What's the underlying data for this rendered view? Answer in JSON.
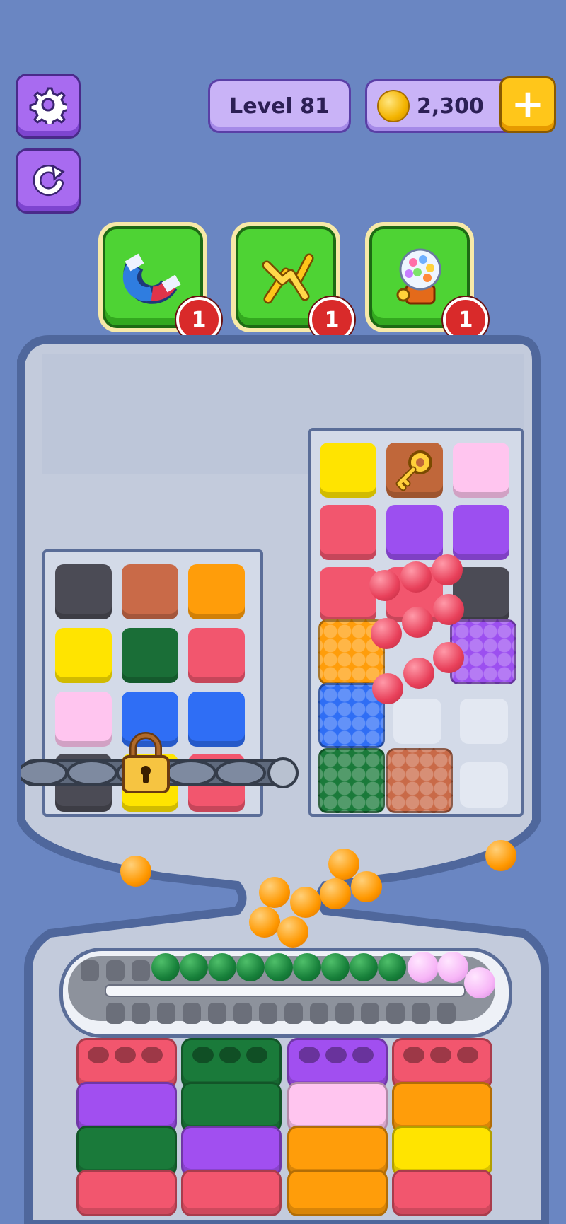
{
  "hud": {
    "level_label": "Level 81",
    "coins": "2,300",
    "plus_label": "+"
  },
  "buttons": {
    "settings_icon": "gear-icon",
    "restart_icon": "restart-icon"
  },
  "boosters": [
    {
      "icon": "magnet-icon",
      "count": "1"
    },
    {
      "icon": "shuffle-arrows-icon",
      "count": "1"
    },
    {
      "icon": "gumball-machine-icon",
      "count": "1"
    }
  ],
  "colors": {
    "background": "#6a86c2",
    "booster_green": "#4ed334",
    "badge_red": "#d92a2a",
    "accent_purple": "#a86bf0"
  },
  "left_grid": {
    "tiles": [
      "#4b4b55",
      "#c96a48",
      "#ff9d0a",
      "#ffe400",
      "#1a6e37",
      "#f2566e",
      "#ffc5ef",
      "#2f6ef5",
      "#2f6ef5"
    ],
    "locked": true,
    "lock_icon": "padlock-icon"
  },
  "right_grid": {
    "tiles": [
      "#ffe400",
      "key-tile",
      "#ffc5ef",
      "#f2566e",
      "#9c4ff0",
      "#9c4ff0",
      "#f2566e",
      "#f2566e",
      "#4b4b55"
    ],
    "key_icon": "key-icon"
  },
  "conveyor": {
    "green_balls": 9,
    "pink_balls": 3
  },
  "bins": [
    [
      "#f2566e",
      "#a14ff0",
      "#1a7a3a",
      "#f2566e"
    ],
    [
      "#1a7a3a",
      "#1a7a3a",
      "#a14ff0",
      "#f2566e"
    ],
    [
      "#a14ff0",
      "#ffc5ef",
      "#ff9d0a",
      "#ff9d0a"
    ],
    [
      "#f2566e",
      "#ff9d0a",
      "#ffe400",
      "#f2566e"
    ]
  ]
}
